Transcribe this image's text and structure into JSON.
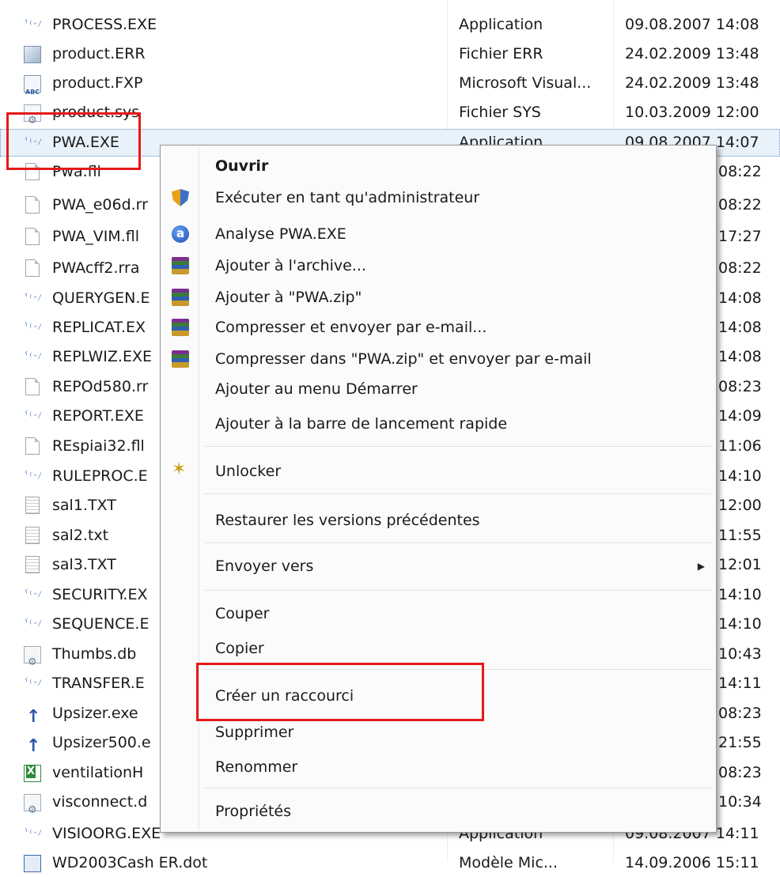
{
  "files": [
    {
      "name": "PROCESS.EXE",
      "icon": "application-icon",
      "type": "Application",
      "date": "09.08.2007 14:08"
    },
    {
      "name": "product.ERR",
      "icon": "err-file-icon",
      "type": "Fichier ERR",
      "date": "24.02.2009 13:48"
    },
    {
      "name": "product.FXP",
      "icon": "fxp-file-icon",
      "type": "Microsoft Visual...",
      "date": "24.02.2009 13:48"
    },
    {
      "name": "product.sys",
      "icon": "system-file-icon",
      "type": "Fichier SYS",
      "date": "10.03.2009 12:00"
    },
    {
      "name": "PWA.EXE",
      "icon": "application-icon",
      "type": "Application",
      "date": "09.08.2007 14:07"
    },
    {
      "name": "Pwa.fll",
      "icon": "blank-file-icon",
      "type": "",
      "date": "08:22"
    },
    {
      "name": "PWA_e06d.rr",
      "icon": "blank-file-icon",
      "type": "",
      "date": "08:22"
    },
    {
      "name": "PWA_VIM.fll",
      "icon": "blank-file-icon",
      "type": "",
      "date": "17:27"
    },
    {
      "name": "PWAcff2.rra",
      "icon": "blank-file-icon",
      "type": "",
      "date": "08:22"
    },
    {
      "name": "QUERYGEN.E",
      "icon": "application-icon",
      "type": "",
      "date": "14:08"
    },
    {
      "name": "REPLICAT.EX",
      "icon": "application-icon",
      "type": "",
      "date": "14:08"
    },
    {
      "name": "REPLWIZ.EXE",
      "icon": "application-icon",
      "type": "",
      "date": "14:08"
    },
    {
      "name": "REPOd580.rr",
      "icon": "blank-file-icon",
      "type": "",
      "date": "08:23"
    },
    {
      "name": "REPORT.EXE",
      "icon": "application-icon",
      "type": "",
      "date": "14:09"
    },
    {
      "name": "REspiai32.fll",
      "icon": "blank-file-icon",
      "type": "",
      "date": "11:06"
    },
    {
      "name": "RULEPROC.E",
      "icon": "application-icon",
      "type": "",
      "date": "14:10"
    },
    {
      "name": "sal1.TXT",
      "icon": "text-file-icon",
      "type": "",
      "date": "12:00"
    },
    {
      "name": "sal2.txt",
      "icon": "text-file-icon",
      "type": "",
      "date": "11:55"
    },
    {
      "name": "sal3.TXT",
      "icon": "text-file-icon",
      "type": "",
      "date": "12:01"
    },
    {
      "name": "SECURITY.EX",
      "icon": "application-icon",
      "type": "",
      "date": "14:10"
    },
    {
      "name": "SEQUENCE.E",
      "icon": "application-icon",
      "type": "",
      "date": "14:10"
    },
    {
      "name": "Thumbs.db",
      "icon": "system-file-icon",
      "type": "",
      "date": "10:43"
    },
    {
      "name": "TRANSFER.E",
      "icon": "application-icon",
      "type": "",
      "date": "14:11"
    },
    {
      "name": "Upsizer.exe",
      "icon": "upsizer-arrow-icon",
      "type": "",
      "date": "08:23"
    },
    {
      "name": "Upsizer500.e",
      "icon": "upsizer-arrow-icon",
      "type": "",
      "date": "21:55"
    },
    {
      "name": "ventilationH",
      "icon": "excel-file-icon",
      "type": "",
      "date": "08:23"
    },
    {
      "name": "visconnect.d",
      "icon": "system-file-icon",
      "type": "",
      "date": "10:34"
    },
    {
      "name": "VISIOORG.EXE",
      "icon": "application-icon",
      "type": "Application",
      "date": "09.08.2007 14:11"
    },
    {
      "name": "WD2003Cash ER.dot",
      "icon": "word-template-icon",
      "type": "Modèle Mic...",
      "date": "14.09.2006 15:11"
    }
  ],
  "menu": {
    "items": [
      {
        "label": "Ouvrir",
        "bold": true,
        "icon": ""
      },
      {
        "label": "Exécuter en tant qu'administrateur",
        "icon": "uac-shield-icon"
      },
      {
        "label": "Analyse PWA.EXE",
        "icon": "antivirus-scan-icon"
      },
      {
        "label": "Ajouter à l'archive...",
        "icon": "winrar-archive-icon"
      },
      {
        "label": "Ajouter à \"PWA.zip\"",
        "icon": "winrar-archive-icon"
      },
      {
        "label": "Compresser et envoyer par e-mail...",
        "icon": "winrar-archive-icon"
      },
      {
        "label": "Compresser dans \"PWA.zip\" et envoyer par e-mail",
        "icon": "winrar-archive-icon"
      },
      {
        "label": "Ajouter au menu Démarrer",
        "icon": ""
      },
      {
        "label": "Ajouter à la barre de lancement rapide",
        "icon": ""
      },
      {
        "label": "Unlocker",
        "icon": "unlocker-wand-icon"
      },
      {
        "label": "Restaurer les versions précédentes",
        "icon": ""
      },
      {
        "label": "Envoyer vers",
        "icon": "",
        "submenu": true
      },
      {
        "label": "Couper",
        "icon": ""
      },
      {
        "label": "Copier",
        "icon": ""
      },
      {
        "label": "Créer un raccourci",
        "icon": ""
      },
      {
        "label": "Supprimer",
        "icon": ""
      },
      {
        "label": "Renommer",
        "icon": ""
      },
      {
        "label": "Propriétés",
        "icon": ""
      }
    ],
    "submenu_arrow": "▶"
  },
  "colors": {
    "highlight_box": "#e61919",
    "selection": "#e8f2fb"
  }
}
